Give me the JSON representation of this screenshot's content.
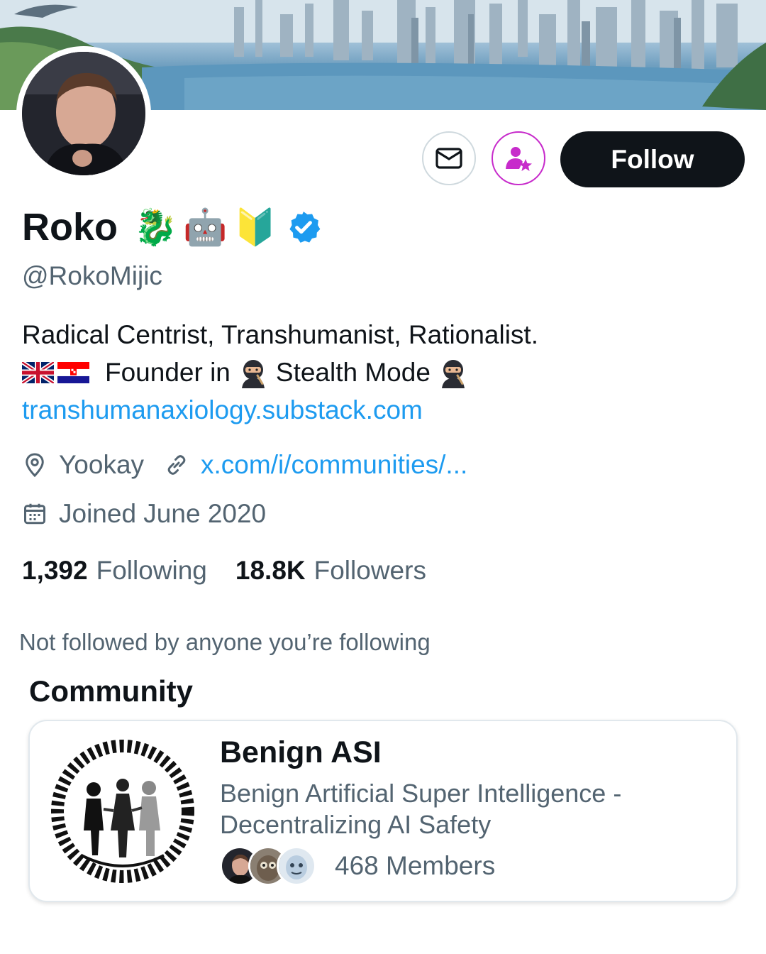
{
  "profile": {
    "display_name": "Roko",
    "name_emojis": [
      "🐉",
      "🤖",
      "🔰"
    ],
    "verified": true,
    "handle": "@RokoMijic",
    "bio": {
      "line1": "Radical Centrist, Transhumanist, Rationalist.",
      "flags": [
        "united-kingdom-flag",
        "croatia-flag"
      ],
      "line2_a": "Founder in",
      "line2_b": "Stealth Mode",
      "link": "transhumanaxiology.substack.com"
    },
    "location": "Yookay",
    "website": "x.com/i/communities/...",
    "joined": "Joined June 2020"
  },
  "actions": {
    "message_icon": "envelope-icon",
    "subscribe_icon": "person-star-icon",
    "follow_label": "Follow"
  },
  "stats": {
    "following_count": "1,392",
    "following_label": "Following",
    "followers_count": "18.8K",
    "followers_label": "Followers"
  },
  "followed_by_text": "Not followed by anyone you’re following",
  "community": {
    "section_title": "Community",
    "name": "Benign ASI",
    "description": "Benign Artificial Super Intelligence - Decentralizing AI Safety",
    "members": "468 Members"
  },
  "colors": {
    "accent": "#1d9bf0",
    "text_primary": "#0f1419",
    "text_secondary": "#536471",
    "subscribe_accent": "#c72bcb",
    "follow_bg": "#0f1419"
  }
}
